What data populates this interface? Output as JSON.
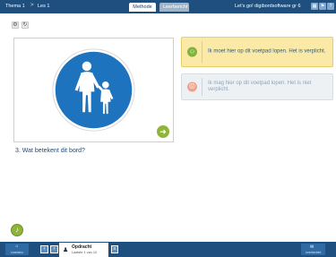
{
  "topbar": {
    "breadcrumb_1": "Thema 1",
    "breadcrumb_2": "Les 1",
    "breadcrumb_sep": ">",
    "tab_methode": "Methode",
    "tab_leerlijn": "Leerbericht",
    "brand": "Let's go! digibordsoftware gr 6",
    "btn_1_icon": "grid-icon",
    "btn_2_icon": "flag-icon",
    "btn_3_icon": "help-icon"
  },
  "tools": {
    "tool_1_icon": "settings-icon",
    "tool_2_icon": "refresh-icon"
  },
  "question": {
    "text": "3. Wat betekent dit bord?"
  },
  "options": [
    {
      "text": "Ik moet hier op dit voetpad lopen. Het is verplicht.",
      "status": "correct"
    },
    {
      "text": "Ik mag hier op dit voetpad lopen. Het is niet verplicht.",
      "status": "incorrect"
    }
  ],
  "bottombar": {
    "menu_label": "Lesmenu",
    "prev_icon": "chevron-left-icon",
    "next_icon": "chevron-right-icon",
    "task_title": "Opdracht",
    "task_sub": "Laatste 1 van 10",
    "right_label": "Leerbericht"
  },
  "colors": {
    "topbar": "#1f4f7e",
    "correct_bg": "#fbe9a6",
    "incorrect_bg": "#eef1f4",
    "accent_green": "#8fb43a",
    "sign_blue": "#1e73be"
  }
}
